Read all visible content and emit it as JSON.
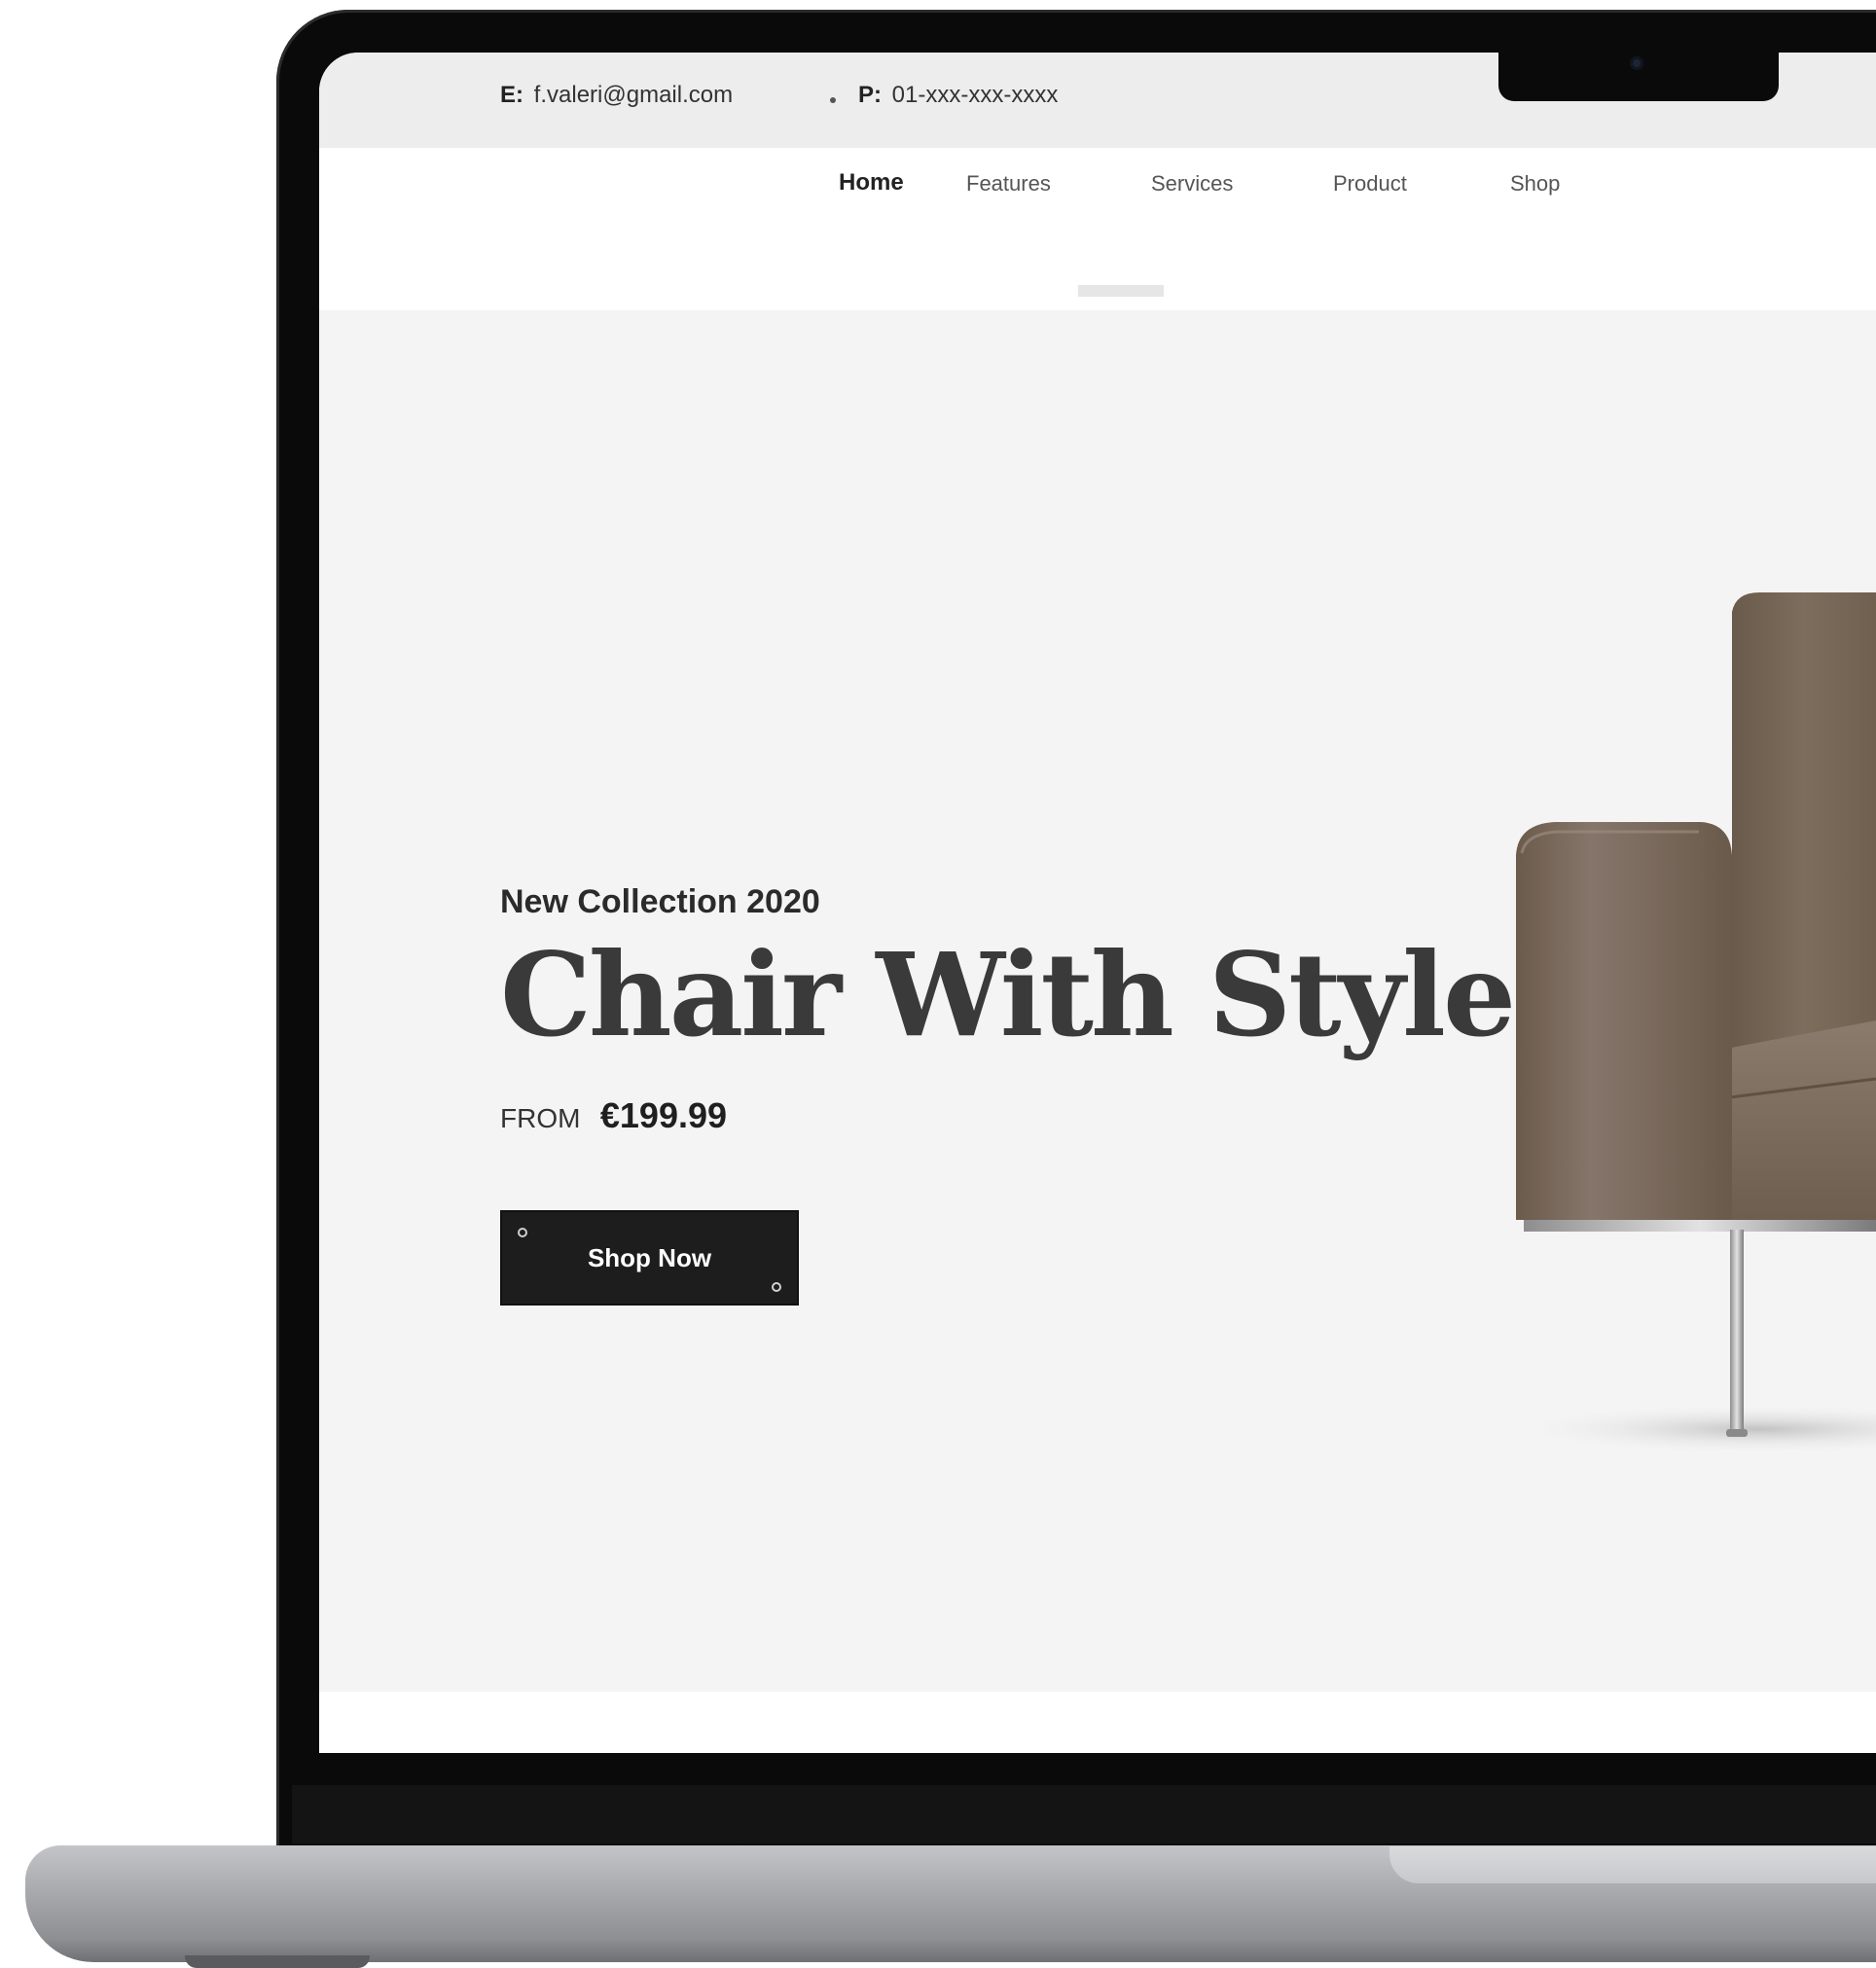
{
  "topbar": {
    "email_key": "E:",
    "email_value": "f.valeri@gmail.com",
    "phone_key": "P:",
    "phone_value": "01-xxx-xxx-xxxx"
  },
  "nav": {
    "items": [
      {
        "label": "Home",
        "active": true
      },
      {
        "label": "Features",
        "active": false
      },
      {
        "label": "Services",
        "active": false
      },
      {
        "label": "Product",
        "active": false
      },
      {
        "label": "Shop",
        "active": false
      }
    ]
  },
  "hero": {
    "eyebrow": "New Collection 2020",
    "headline": "Chair With Style",
    "price_prefix": "FROM",
    "price_value": "€199.99",
    "cta_label": "Shop Now",
    "product_image": "brown-armchair-image"
  },
  "colors": {
    "accent_dark": "#1d1d1d",
    "hero_bg": "#f4f4f4",
    "topbar_bg": "#ededed",
    "chair_fabric": "#7a6a5a"
  }
}
